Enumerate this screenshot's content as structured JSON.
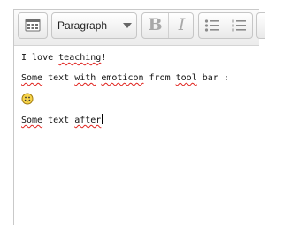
{
  "toolbar": {
    "format_select": {
      "value": "Paragraph"
    },
    "bold_label": "B",
    "italic_label": "I",
    "icons": [
      "toolbar-toggle-icon",
      "chevron-down-icon",
      "bullet-list-icon",
      "numbered-list-icon"
    ]
  },
  "content": {
    "paragraphs": [
      {
        "parts": [
          "I love ",
          "teaching",
          "!"
        ]
      },
      {
        "parts": [
          "Some",
          " text ",
          "with",
          " ",
          "emoticon",
          " from ",
          "tool",
          " bar :"
        ]
      },
      {
        "emoticon": "smiley-emoticon-icon"
      },
      {
        "parts": [
          "Some",
          " text ",
          "after"
        ]
      }
    ]
  },
  "colors": {
    "spellcheck_underline": "#e0211c",
    "emoticon_face": "#f7d44a"
  }
}
